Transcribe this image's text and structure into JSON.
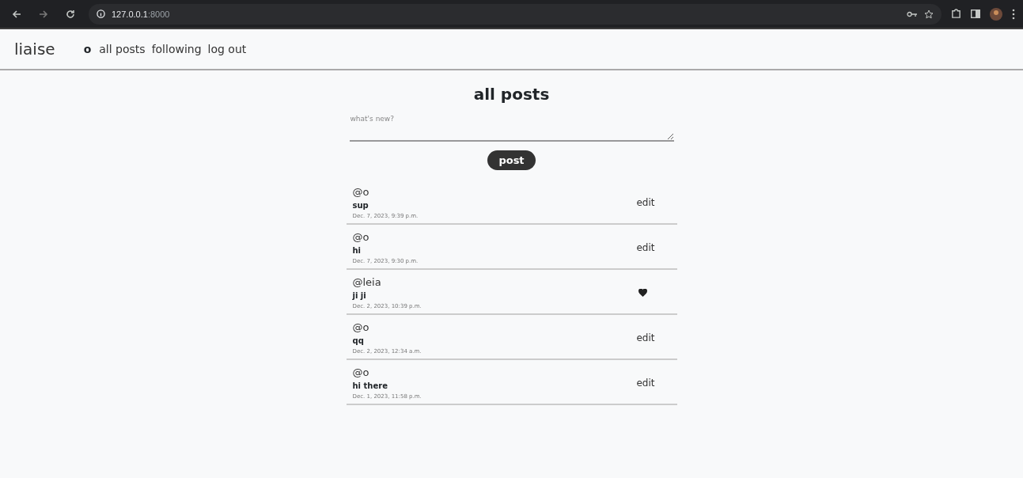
{
  "browser": {
    "url_host": "127.0.0.1",
    "url_port": ":8000"
  },
  "nav": {
    "brand": "liaise",
    "user": "o",
    "links": [
      "all posts",
      "following",
      "log out"
    ]
  },
  "page": {
    "title": "all posts",
    "composer": {
      "placeholder": "what's new?"
    },
    "post_button": "post"
  },
  "posts": [
    {
      "author": "@o",
      "body": "sup",
      "time": "Dec. 7, 2023, 9:39 p.m.",
      "action": {
        "kind": "edit",
        "label": "edit"
      }
    },
    {
      "author": "@o",
      "body": "hi",
      "time": "Dec. 7, 2023, 9:30 p.m.",
      "action": {
        "kind": "edit",
        "label": "edit"
      }
    },
    {
      "author": "@leia",
      "body": "ji ji",
      "time": "Dec. 2, 2023, 10:39 p.m.",
      "action": {
        "kind": "like",
        "liked": true
      }
    },
    {
      "author": "@o",
      "body": "qq",
      "time": "Dec. 2, 2023, 12:34 a.m.",
      "action": {
        "kind": "edit",
        "label": "edit"
      }
    },
    {
      "author": "@o",
      "body": "hi there",
      "time": "Dec. 1, 2023, 11:58 p.m.",
      "action": {
        "kind": "edit",
        "label": "edit"
      }
    }
  ]
}
